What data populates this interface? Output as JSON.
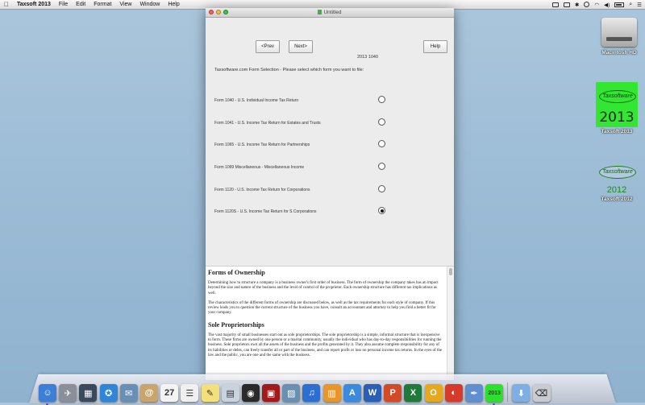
{
  "menubar": {
    "app_name": "Taxsoft 2013",
    "items": [
      "File",
      "Edit",
      "Format",
      "View",
      "Window",
      "Help"
    ]
  },
  "desktop": {
    "icons": [
      {
        "label": "Macintosh HD"
      },
      {
        "label": "Taxsoft 2013",
        "logo_text": "Taxsoftware",
        "year": "2013"
      },
      {
        "label": "Taxsoft 2012",
        "logo_text": "Taxsoftware",
        "year": "2012"
      }
    ]
  },
  "window": {
    "title": "Untitled",
    "prev_label": "<Prev",
    "next_label": "Next>",
    "help_label": "Help",
    "form_year": "2013 1040",
    "instructions": "Taxsoftware.com Form Selection - Please select which form you want to file:",
    "forms": [
      {
        "label": "Form 1040 - U.S. Individual Income Tax Return",
        "selected": false
      },
      {
        "label": "Form 1041 - U.S. Income Tax Return for Estates and Trusts",
        "selected": false
      },
      {
        "label": "Form 1065 - U.S. Income Tax Return for Partnerships",
        "selected": false
      },
      {
        "label": "Form 1099 Miscellaneous - Miscellaneous Income",
        "selected": false
      },
      {
        "label": "Form 1120 - U.S. Income Tax Return for Corporations",
        "selected": false
      },
      {
        "label": "Form 1120S - U.S. Income Tax Return for S Corporations",
        "selected": true
      }
    ]
  },
  "document": {
    "heading1": "Forms of Ownership",
    "para1": "Determining how to structure a company is a business owner's first order of business. The form of ownership the company takes has an impact beyond the size and nature of the business and the level of control of the proprietor. Each ownership structure has different tax implications as well.",
    "para2": "The characteristics of the different forms of ownership are discussed below, as well as the tax requirements for each style of company. If this review leads you to question the current structure of the business you have, consult an accountant and attorney to help you find a better fit for your company.",
    "heading2": "Sole Proprietorships",
    "para3": "The vast majority of small businesses start out as sole proprietorships. The sole proprietorship is a simple, informal structure that is inexpensive to form. These firms are owned by one person or a marital community, usually the individual who has day-to-day responsibilities for running the business. Sole proprietors own all the assets of the business and the profits generated by it. They also assume complete responsibility for any of its liabilities or debts, can freely transfer all or part of the business, and can report profit or loss on personal income tax returns. In the eyes of the law and the public, you are one and the same with the business."
  },
  "dock": {
    "icons": [
      {
        "name": "finder-icon",
        "color": "#3b7fd6",
        "glyph": "☺"
      },
      {
        "name": "launchpad-icon",
        "color": "#8a8f99",
        "glyph": "✈"
      },
      {
        "name": "mission-control-icon",
        "color": "#3a4a5c",
        "glyph": "▦"
      },
      {
        "name": "safari-icon",
        "color": "#2f86d9",
        "glyph": "✪"
      },
      {
        "name": "mail-icon",
        "color": "#6a8fb5",
        "glyph": "✉"
      },
      {
        "name": "contacts-icon",
        "color": "#c9a46b",
        "glyph": "@"
      },
      {
        "name": "calendar-icon",
        "color": "#f4f4f4",
        "glyph": "27"
      },
      {
        "name": "reminders-icon",
        "color": "#f0f0f0",
        "glyph": "☰"
      },
      {
        "name": "notes-icon",
        "color": "#f3e07a",
        "glyph": "✎"
      },
      {
        "name": "preview-icon",
        "color": "#c8d3dd",
        "glyph": "▤"
      },
      {
        "name": "dvd-icon",
        "color": "#2a2a2a",
        "glyph": "◉"
      },
      {
        "name": "photobooth-icon",
        "color": "#a31a1a",
        "glyph": "▣"
      },
      {
        "name": "iphoto-icon",
        "color": "#6b8fb0",
        "glyph": "▨"
      },
      {
        "name": "itunes-icon",
        "color": "#2d6fd1",
        "glyph": "♫"
      },
      {
        "name": "ibooks-icon",
        "color": "#e8962a",
        "glyph": "▥"
      },
      {
        "name": "app-store-icon",
        "color": "#3a8be0",
        "glyph": "A"
      },
      {
        "name": "word-icon",
        "color": "#2b5fb3",
        "glyph": "W"
      },
      {
        "name": "powerpoint-icon",
        "color": "#d24a26",
        "glyph": "P"
      },
      {
        "name": "excel-icon",
        "color": "#1f7a3a",
        "glyph": "X"
      },
      {
        "name": "outlook-icon",
        "color": "#e8a81e",
        "glyph": "O"
      },
      {
        "name": "photo-booth-red-icon",
        "color": "#d63a2a",
        "glyph": "◐"
      },
      {
        "name": "xcode-icon",
        "color": "#5f8fd1",
        "glyph": "✒"
      },
      {
        "name": "taxsoft-icon",
        "color": "#2ee02e",
        "glyph": "2013"
      }
    ],
    "right_icons": [
      {
        "name": "downloads-folder-icon",
        "color": "#7eaee6",
        "glyph": "⬇"
      },
      {
        "name": "trash-icon",
        "color": "#c8ccd2",
        "glyph": "⌫"
      }
    ]
  }
}
